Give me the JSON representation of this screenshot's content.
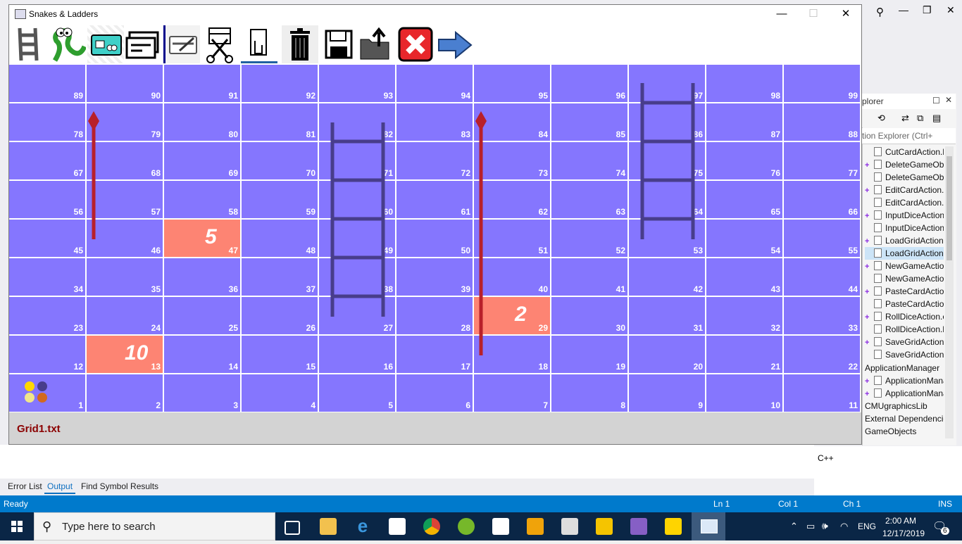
{
  "window": {
    "title": "Snakes & Ladders",
    "minimize_glyph": "—",
    "maximize_glyph": "☐",
    "close_glyph": "✕"
  },
  "toolbar": [
    {
      "name": "add-ladder-icon"
    },
    {
      "name": "add-snake-icon"
    },
    {
      "name": "add-card-icon"
    },
    {
      "name": "copy-card-icon"
    },
    {
      "name": "edit-card-icon"
    },
    {
      "name": "cut-card-icon"
    },
    {
      "name": "paste-card-icon"
    },
    {
      "name": "delete-icon"
    },
    {
      "name": "save-grid-icon"
    },
    {
      "name": "open-grid-icon"
    },
    {
      "name": "exit-icon"
    },
    {
      "name": "switch-to-play-mode-icon"
    }
  ],
  "board": {
    "rows": [
      [
        89,
        90,
        91,
        92,
        93,
        94,
        95,
        96,
        97,
        98,
        99
      ],
      [
        78,
        79,
        80,
        81,
        82,
        83,
        84,
        85,
        86,
        87,
        88
      ],
      [
        67,
        68,
        69,
        70,
        71,
        72,
        73,
        74,
        75,
        76,
        77
      ],
      [
        56,
        57,
        58,
        59,
        60,
        61,
        62,
        63,
        64,
        65,
        66
      ],
      [
        45,
        46,
        47,
        48,
        49,
        50,
        51,
        52,
        53,
        54,
        55
      ],
      [
        34,
        35,
        36,
        37,
        38,
        39,
        40,
        41,
        42,
        43,
        44
      ],
      [
        23,
        24,
        25,
        26,
        27,
        28,
        29,
        30,
        31,
        32,
        33
      ],
      [
        12,
        13,
        14,
        15,
        16,
        17,
        18,
        19,
        20,
        21,
        22
      ],
      [
        1,
        2,
        3,
        4,
        5,
        6,
        7,
        8,
        9,
        10,
        11
      ]
    ],
    "cards": [
      {
        "cell": 47,
        "number": "5"
      },
      {
        "cell": 29,
        "number": "2"
      },
      {
        "cell": 13,
        "number": "10"
      }
    ],
    "colors": {
      "cell": "#8576fe",
      "card": "#fd8473",
      "snake": "#b8202a",
      "ladder": "#483d8b"
    },
    "player_colors": [
      "#ffd700",
      "#483d8b",
      "#f0e68c",
      "#d2691e"
    ]
  },
  "status": {
    "file": "Grid1.txt"
  },
  "solution_explorer": {
    "header": "plorer",
    "search": "tion Explorer (Ctrl+",
    "items": [
      {
        "label": "CutCardAction.h",
        "plus": false
      },
      {
        "label": "DeleteGameObjec",
        "plus": true
      },
      {
        "label": "DeleteGameObjec",
        "plus": false
      },
      {
        "label": "EditCardAction.cp",
        "plus": true
      },
      {
        "label": "EditCardAction.h",
        "plus": false
      },
      {
        "label": "InputDiceAction.c",
        "plus": true
      },
      {
        "label": "InputDiceAction.h",
        "plus": false
      },
      {
        "label": "LoadGridAction.cp",
        "plus": true
      },
      {
        "label": "LoadGridAction.h",
        "plus": false
      },
      {
        "label": "NewGameAction.",
        "plus": true
      },
      {
        "label": "NewGameAction.",
        "plus": false
      },
      {
        "label": "PasteCardAction.c",
        "plus": true
      },
      {
        "label": "PasteCardAction.h",
        "plus": false
      },
      {
        "label": "RollDiceAction.cp",
        "plus": true
      },
      {
        "label": "RollDiceAction.h",
        "plus": false
      },
      {
        "label": "SaveGridAction.cp",
        "plus": true
      },
      {
        "label": "SaveGridAction.h",
        "plus": false
      }
    ],
    "groups": [
      "ApplicationManager",
      "ApplicationManag",
      "ApplicationManag",
      "CMUgraphicsLib",
      "External Dependencie",
      "GameObjects"
    ],
    "cpp_label": "C++"
  },
  "output_tabs": [
    "Error List",
    "Output",
    "Find Symbol Results"
  ],
  "statusbar": {
    "ready": "Ready",
    "ln": "Ln 1",
    "col": "Col 1",
    "ch": "Ch 1",
    "ins": "INS"
  },
  "taskbar": {
    "search_placeholder": "Type here to search",
    "language": "ENG",
    "time": "2:00 AM",
    "date": "12/17/2019",
    "notification_count": "6"
  }
}
